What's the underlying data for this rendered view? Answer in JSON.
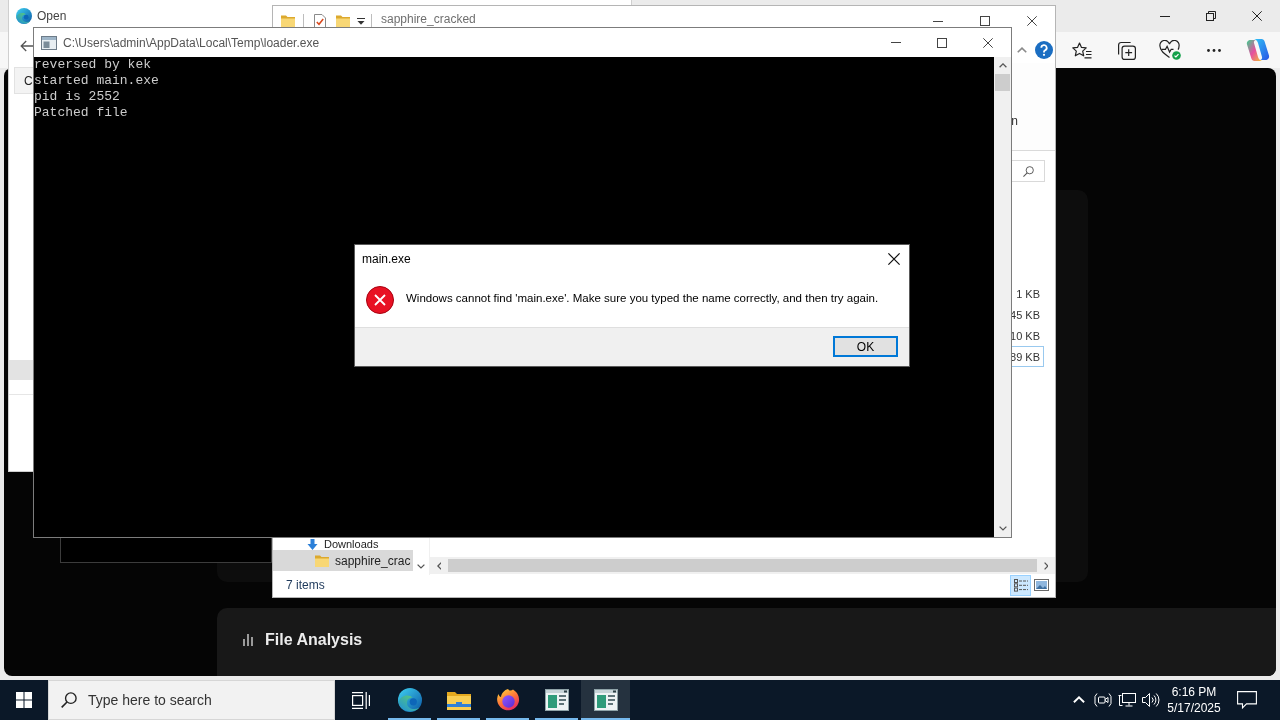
{
  "browser": {
    "section_title": "File Analysis"
  },
  "open_dialog": {
    "title": "Open",
    "fragment": "C"
  },
  "explorer": {
    "title": "sapphire_cracked",
    "ribbon_fragment": "n",
    "files": [
      {
        "size": "1 KB",
        "selected": false
      },
      {
        "size": "45 KB",
        "selected": false
      },
      {
        "size": "10 KB",
        "selected": false
      },
      {
        "size": "89 KB",
        "selected": true
      }
    ],
    "nav_items": [
      {
        "kind": "downloads",
        "label": "Downloads",
        "selected": false,
        "children": [
          {
            "kind": "folder",
            "label": "sapphire_crac",
            "selected": true
          }
        ]
      }
    ],
    "status": "7 items",
    "views": [
      {
        "kind": "details",
        "selected": true
      },
      {
        "kind": "large_icons",
        "selected": false
      }
    ]
  },
  "console": {
    "title": "C:\\Users\\admin\\AppData\\Local\\Temp\\loader.exe",
    "lines": [
      "reversed by kek",
      "started main.exe",
      "pid is 2552",
      "Patched file"
    ]
  },
  "error_dialog": {
    "title": "main.exe",
    "message": "Windows cannot find 'main.exe'. Make sure you typed the name correctly, and then try again.",
    "buttons": [
      {
        "label": "OK",
        "default": true
      }
    ]
  },
  "taskbar": {
    "search": {
      "placeholder": "Type here to search"
    },
    "apps": [
      {
        "kind": "edge",
        "running": true,
        "selected": false
      },
      {
        "kind": "explorer",
        "running": true,
        "selected": false
      },
      {
        "kind": "firefox",
        "running": true,
        "selected": false
      },
      {
        "kind": "window",
        "running": true,
        "selected": false
      },
      {
        "kind": "window",
        "running": true,
        "selected": true
      }
    ],
    "time": "6:16 PM",
    "date": "5/17/2025"
  }
}
